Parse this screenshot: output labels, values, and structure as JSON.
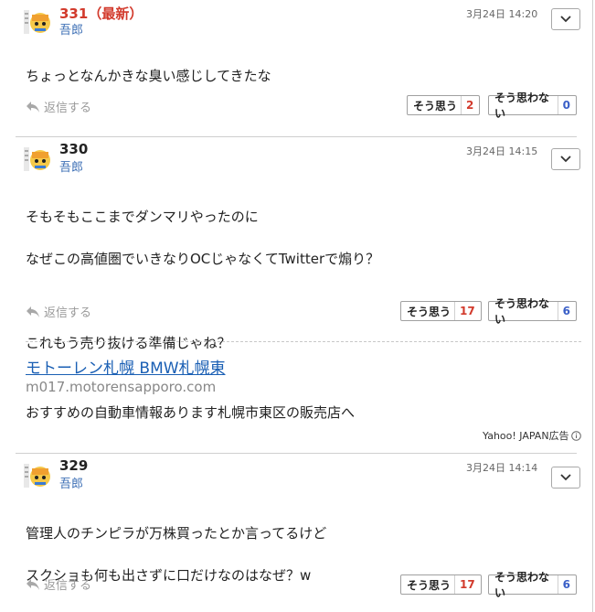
{
  "posts": [
    {
      "number": "331",
      "latest_tag": "（最新）",
      "author": "吾郎",
      "date": "3月24日 14:20",
      "lines": [
        "ちょっとなんかきな臭い感じしてきたな"
      ],
      "reply_label": "返信する",
      "agree_label": "そう思う",
      "agree_count": "2",
      "disagree_label": "そう思わない",
      "disagree_count": "0"
    },
    {
      "number": "330",
      "author": "吾郎",
      "date": "3月24日 14:15",
      "lines": [
        "そもそもここまでダンマリやったのに",
        "なぜこの高値圏でいきなりOCじゃなくてTwitterで煽り？",
        "",
        "これもう売り抜ける準備じゃね？"
      ],
      "reply_label": "返信する",
      "agree_label": "そう思う",
      "agree_count": "17",
      "disagree_label": "そう思わない",
      "disagree_count": "6"
    },
    {
      "number": "329",
      "author": "吾郎",
      "date": "3月24日 14:14",
      "lines": [
        "管理人のチンピラが万株買ったとか言ってるけど",
        "スクショも何も出さずに口だけなのはなぜ？w"
      ],
      "reply_label": "返信する",
      "agree_label": "そう思う",
      "agree_count": "17",
      "disagree_label": "そう思わない",
      "disagree_count": "6"
    }
  ],
  "ad": {
    "title": "モトーレン札幌 BMW札幌東",
    "url": "m017.motorensapporo.com",
    "description": "おすすめの自動車情報あります札幌市東区の販売店へ",
    "label": "Yahoo! JAPAN広告"
  },
  "icons": {
    "avatar": "avatar-icon",
    "menu": "chevron-down-icon",
    "reply": "reply-arrow-icon",
    "ad_info": "info-icon"
  },
  "colors": {
    "latest": "#d23a2c",
    "author": "#3d6fb5",
    "agree_count": "#d23a2c",
    "disagree_count": "#3a5fc7",
    "ad_link": "#1a5fb4"
  }
}
